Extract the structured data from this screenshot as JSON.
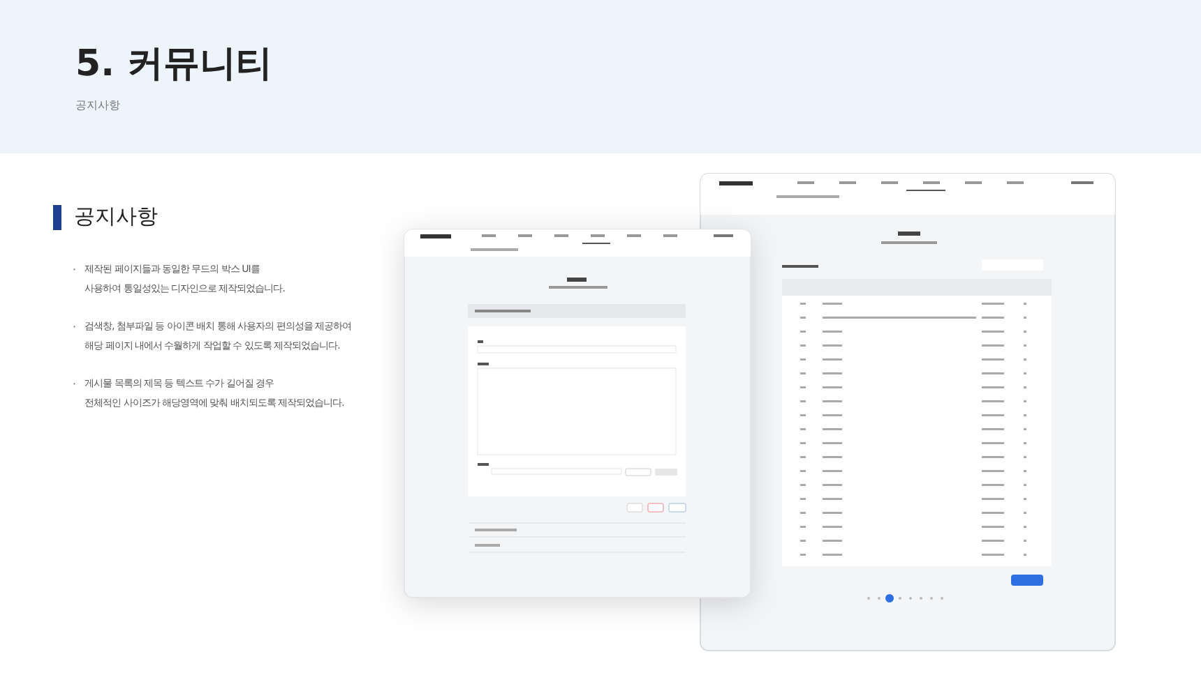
{
  "header": {
    "title": "5. 커뮤니티",
    "subtitle": "공지사항"
  },
  "section": {
    "title": "공지사항",
    "bullets": [
      {
        "mark": "·",
        "lines": [
          "제작된 페이지들과 동일한 무드의 박스 UI를",
          "사용하여 통일성있는 디자인으로 제작되었습니다."
        ]
      },
      {
        "mark": "·",
        "lines": [
          "검색창, 첨부파일 등 아이콘 배치 통해 사용자의 편의성을 제공하여",
          "해당 페이지 내에서 수월하게 작업할 수 있도록 제작되었습니다."
        ]
      },
      {
        "mark": "·",
        "lines": [
          "게시물 목록의 제목 등 텍스트 수가 길어질 경우",
          "전체적인 사이즈가 해당영역에 맞춰 배치되도록 제작되었습니다."
        ]
      }
    ]
  }
}
